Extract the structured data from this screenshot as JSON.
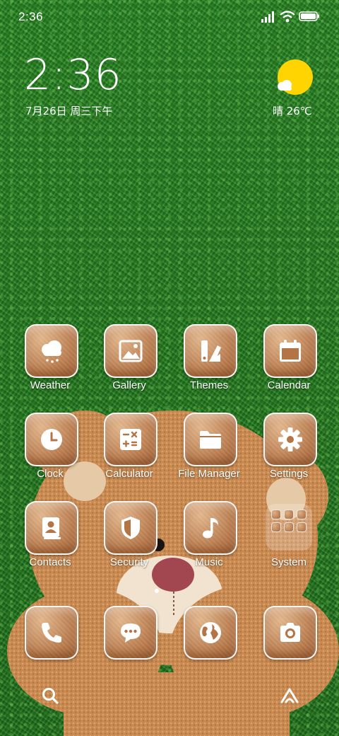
{
  "status": {
    "time": "2:36"
  },
  "clock_widget": {
    "time": "2:36",
    "date": "7月26日 周三下午"
  },
  "weather_widget": {
    "text": "晴 26℃",
    "sun_color": "#ffd400"
  },
  "apps": {
    "weather": {
      "label": "Weather",
      "icon": "cloud-rain-icon"
    },
    "gallery": {
      "label": "Gallery",
      "icon": "image-icon"
    },
    "themes": {
      "label": "Themes",
      "icon": "brush-palette-icon"
    },
    "calendar": {
      "label": "Calendar",
      "icon": "calendar-icon"
    },
    "clock": {
      "label": "Clock",
      "icon": "clock-icon"
    },
    "calculator": {
      "label": "Calculator",
      "icon": "calculator-icon"
    },
    "file_manager": {
      "label": "File Manager",
      "icon": "folder-icon"
    },
    "settings": {
      "label": "Settings",
      "icon": "gear-icon"
    },
    "contacts": {
      "label": "Contacts",
      "icon": "contacts-book-icon"
    },
    "security": {
      "label": "Security",
      "icon": "shield-icon"
    },
    "music": {
      "label": "Music",
      "icon": "music-note-icon"
    },
    "system": {
      "label": "System",
      "icon": "folder-grid-icon"
    }
  },
  "dock": {
    "phone": {
      "icon": "phone-icon"
    },
    "messages": {
      "icon": "chat-bubble-icon"
    },
    "browser": {
      "icon": "globe-icon"
    },
    "camera": {
      "icon": "camera-icon"
    }
  },
  "nav": {
    "search_icon": "search-icon",
    "home_icon": "home-arrow-icon"
  },
  "colors": {
    "tile_brown": "#b37446",
    "grass_green": "#2f8a2c",
    "label_white": "#ffffff"
  }
}
